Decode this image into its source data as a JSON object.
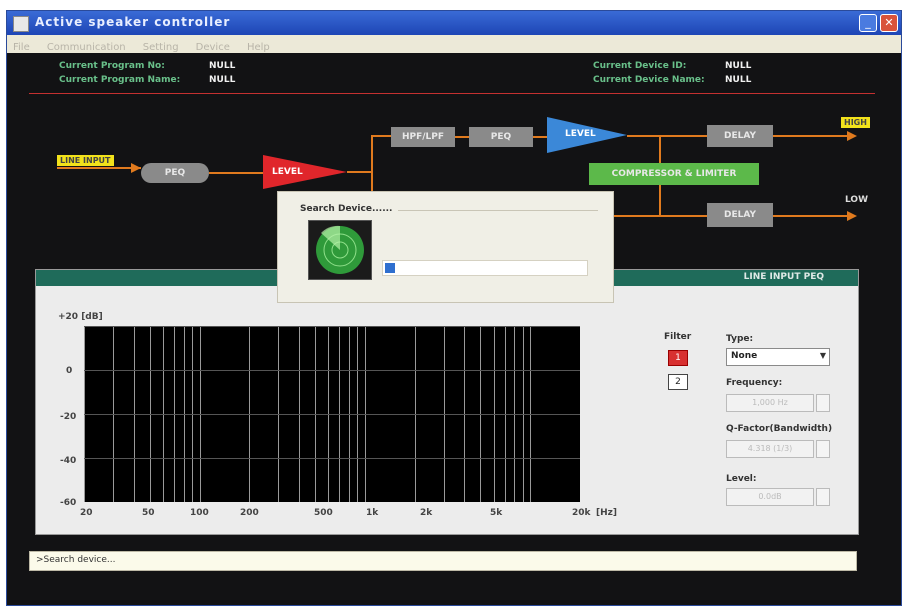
{
  "window": {
    "title": "Active speaker controller"
  },
  "menu": {
    "items": [
      "File",
      "Communication",
      "Setting",
      "Device",
      "Help"
    ]
  },
  "info": {
    "program_no_label": "Current Program No:",
    "program_no_value": "NULL",
    "program_name_label": "Current Program Name:",
    "program_name_value": "NULL",
    "device_id_label": "Current Device ID:",
    "device_id_value": "NULL",
    "device_name_label": "Current Device Name:",
    "device_name_value": "NULL"
  },
  "flow": {
    "line_input": "LINE INPUT",
    "peq_input": "PEQ",
    "level_input": "LEVEL",
    "hpf_lpf": "HPF/LPF",
    "peq_high": "PEQ",
    "level_high": "LEVEL",
    "delay_high": "DELAY",
    "compressor": "COMPRESSOR & LIMITER",
    "delay_low": "DELAY",
    "high_out": "HIGH",
    "low_out": "LOW"
  },
  "dialog": {
    "title": "Search Device......",
    "progress": 0.05
  },
  "peq_panel": {
    "title": "LINE INPUT PEQ",
    "y_title": "+20 [dB]",
    "y_ticks": [
      "0",
      "-20",
      "-40",
      "-60"
    ],
    "x_ticks": [
      "20",
      "50",
      "100",
      "200",
      "500",
      "1k",
      "2k",
      "5k",
      "20k"
    ],
    "x_unit": "[Hz]",
    "filter_label": "Filter",
    "filter_buttons": [
      "1",
      "2"
    ],
    "type_label": "Type:",
    "type_value": "None",
    "frequency_label": "Frequency:",
    "frequency_value": "1,000 Hz",
    "qfactor_label": "Q-Factor(Bandwidth)",
    "qfactor_value": "4.318 (1/3)",
    "level_label": "Level:",
    "level_value": "0.0dB"
  },
  "status": {
    "text": ">Search device..."
  },
  "colors": {
    "background": "#121214",
    "accent_green": "#69c08a",
    "wire_orange": "#e07a1e",
    "level_red": "#e0262b",
    "level_blue": "#3b88d8",
    "compressor_green": "#5cb94a",
    "output_yellow": "#f2e21b",
    "filter_active_red": "#d83030"
  }
}
